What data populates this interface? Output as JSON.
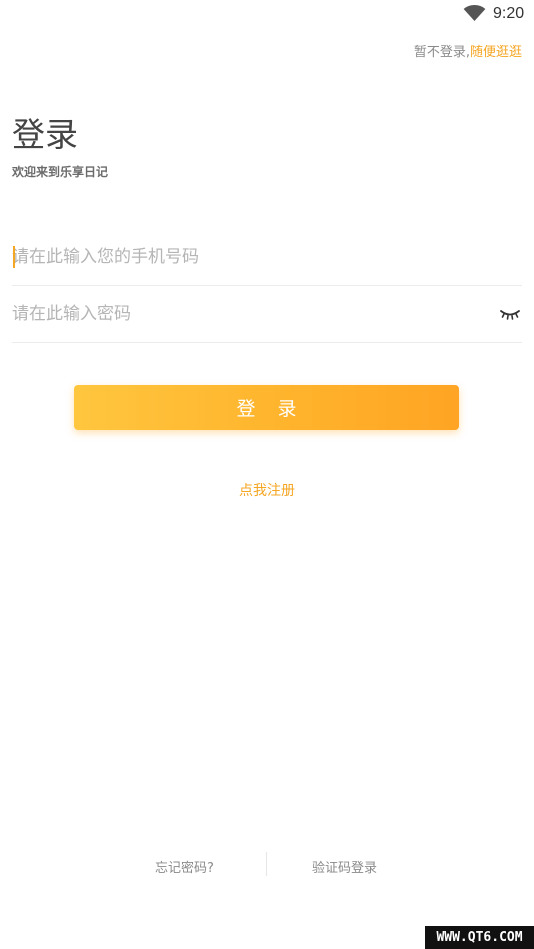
{
  "status_bar": {
    "time": "9:20",
    "icons": [
      "wifi-icon"
    ]
  },
  "header": {
    "skip_prefix": "暂不登录,",
    "skip_link": "随便逛逛"
  },
  "title": "登录",
  "subtitle": "欢迎来到乐享日记",
  "form": {
    "phone_placeholder": "请在此输入您的手机号码",
    "phone_value": "",
    "password_placeholder": "请在此输入密码",
    "password_value": "",
    "password_toggle_icon": "eye-closed-icon"
  },
  "login_button_label": "登 录",
  "register_link": "点我注册",
  "footer": {
    "forgot_password": "忘记密码?",
    "sms_login": "验证码登录"
  },
  "watermark": "WWW.QT6.COM",
  "colors": {
    "accent": "#f5a623",
    "button_start": "#ffc63e",
    "button_end": "#ffa424"
  }
}
